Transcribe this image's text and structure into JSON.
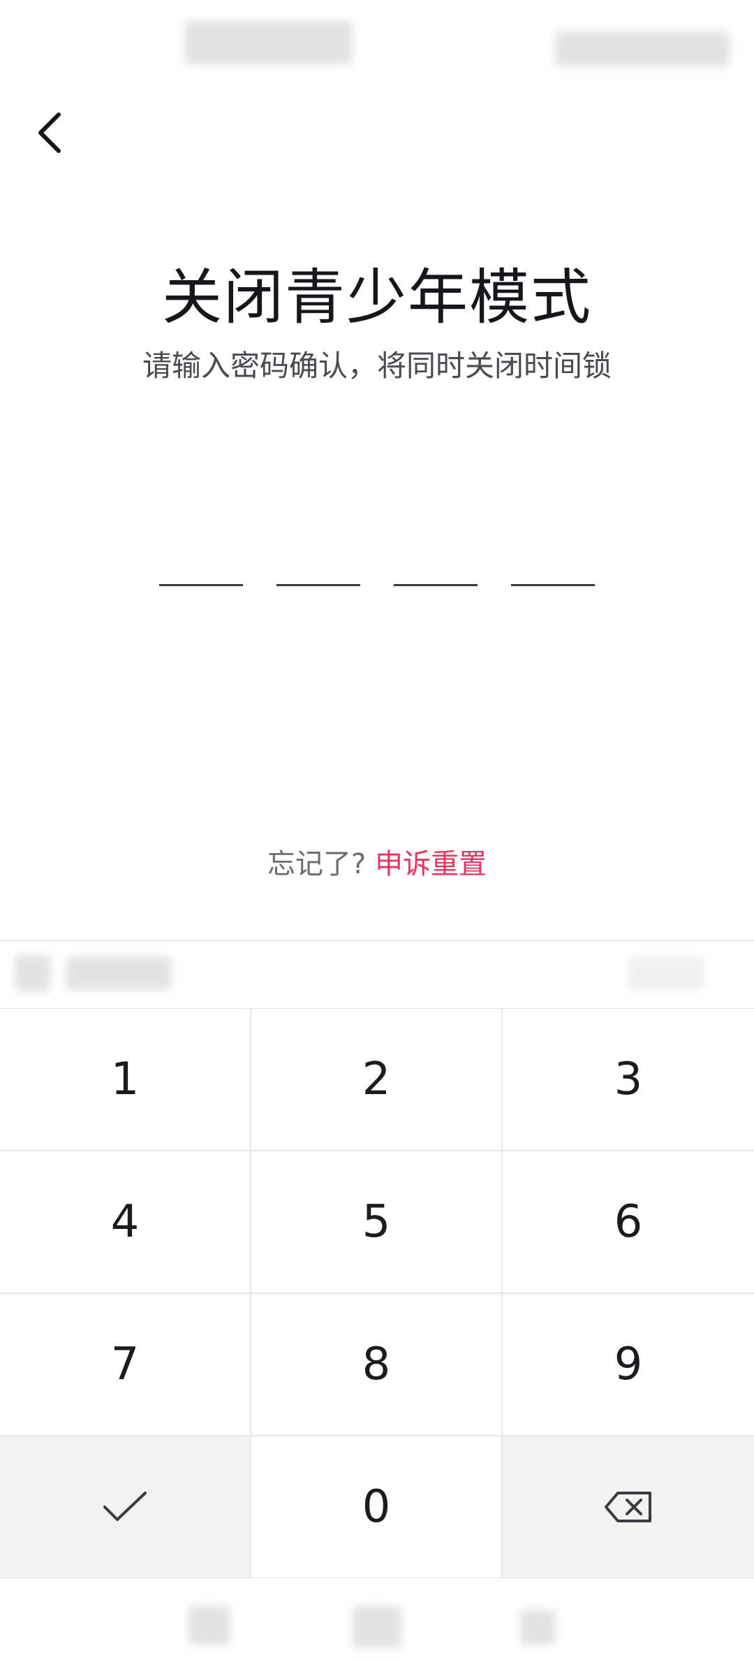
{
  "header": {
    "title": "关闭青少年模式",
    "subtitle": "请输入密码确认，将同时关闭时间锁"
  },
  "pin": {
    "slots": 4
  },
  "forgot": {
    "prompt": "忘记了?",
    "link_label": "申诉重置"
  },
  "keypad": {
    "keys": [
      "1",
      "2",
      "3",
      "4",
      "5",
      "6",
      "7",
      "8",
      "9",
      "0"
    ],
    "confirm_icon": "check-icon",
    "delete_icon": "backspace-icon"
  },
  "colors": {
    "accent": "#e8325f",
    "title": "#16161d",
    "divider": "#e6e6e6",
    "func_key_bg": "#f2f2f2"
  }
}
